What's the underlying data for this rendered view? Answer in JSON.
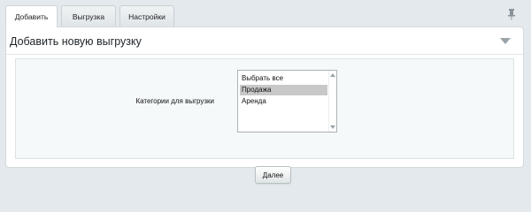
{
  "tabs": [
    {
      "label": "Добавить",
      "active": true
    },
    {
      "label": "Выгрузка",
      "active": false
    },
    {
      "label": "Настройки",
      "active": false
    }
  ],
  "icons": {
    "pin": "pin-icon",
    "collapse": "chevron-down-icon"
  },
  "panel": {
    "title": "Добавить новую выгрузку"
  },
  "form": {
    "categories_label": "Категории для выгрузки",
    "options": [
      {
        "label": "Выбрать все",
        "selected": false
      },
      {
        "label": "Продажа",
        "selected": true
      },
      {
        "label": "Аренда",
        "selected": false
      }
    ],
    "next_button": "Далее"
  },
  "colors": {
    "background": "#e3e9ec",
    "selection": "#c8c8c8",
    "form_bg": "#f5f9f9"
  }
}
